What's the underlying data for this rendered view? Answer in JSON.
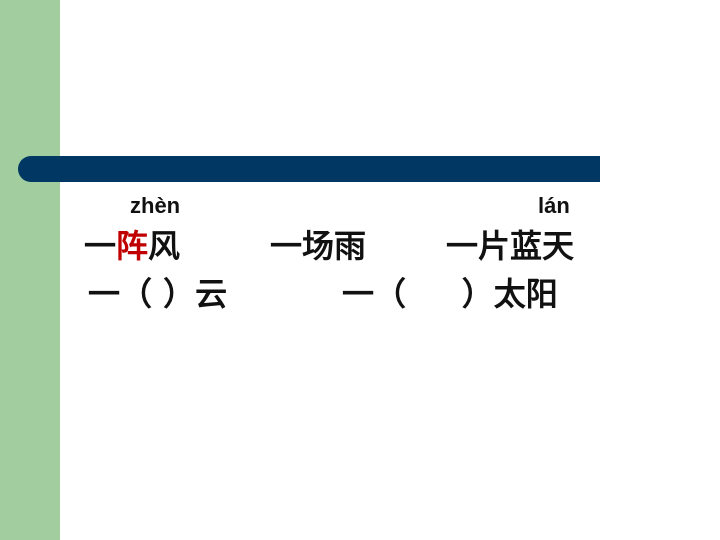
{
  "slide": {
    "pinyin_left": "zhèn",
    "pinyin_right": "lán",
    "row1": {
      "phrase1_prefix": "一",
      "phrase1_highlight": "阵",
      "phrase1_suffix": "风",
      "phrase2": "一场雨",
      "phrase3": "一片蓝天"
    },
    "row2": {
      "phrase1": "一（ ）云",
      "phrase2": "一（     ）太阳"
    }
  },
  "colors": {
    "sidebar": "#a2cd9f",
    "title_bar": "#003763",
    "highlight": "#c00000"
  }
}
